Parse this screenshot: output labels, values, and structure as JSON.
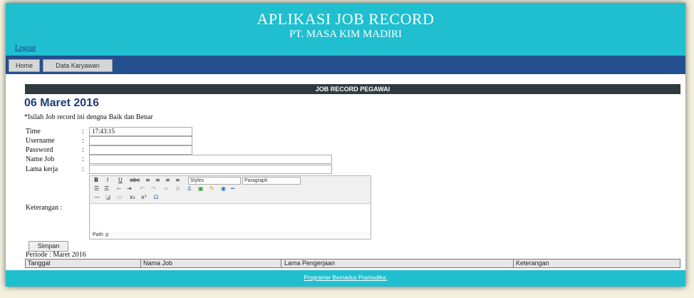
{
  "header": {
    "app_title": "APLIKASI JOB RECORD",
    "company": "PT. MASA KIM MADIRI",
    "logout_label": "Logout"
  },
  "nav": {
    "items": [
      {
        "label": "Home"
      },
      {
        "label": "Data Karyawan"
      }
    ]
  },
  "content": {
    "section_title": "JOB RECORD PEGAWAI",
    "date": "06 Maret 2016",
    "instruction": "*Isilah Job record ini dengna Baik dan Benar"
  },
  "form": {
    "time_label": "Time",
    "time_value": "17:43:15",
    "username_label": "Username",
    "password_label": "Password",
    "namejob_label": "Name Job",
    "lamakerja_label": "Lama kerja",
    "keterangan_label": "Keterangan :",
    "colon": ":"
  },
  "editor": {
    "styles_value": "Styles",
    "format_value": "Paragraph",
    "path_text": "Path: p"
  },
  "actions": {
    "save_label": "Simpan"
  },
  "period": {
    "text": "Periode : Maret 2016"
  },
  "table": {
    "headers": [
      "Tanggal",
      "Nama Job",
      "Lama Pengerjaan",
      "Keterangan"
    ]
  },
  "footer": {
    "text": "Programer Bernadus Pramudika."
  },
  "colors": {
    "header_bg": "#1fbfcf",
    "nav_bg": "#24508f",
    "section_title_bg": "#2f3b3e",
    "date_heading": "#1d3c78"
  }
}
